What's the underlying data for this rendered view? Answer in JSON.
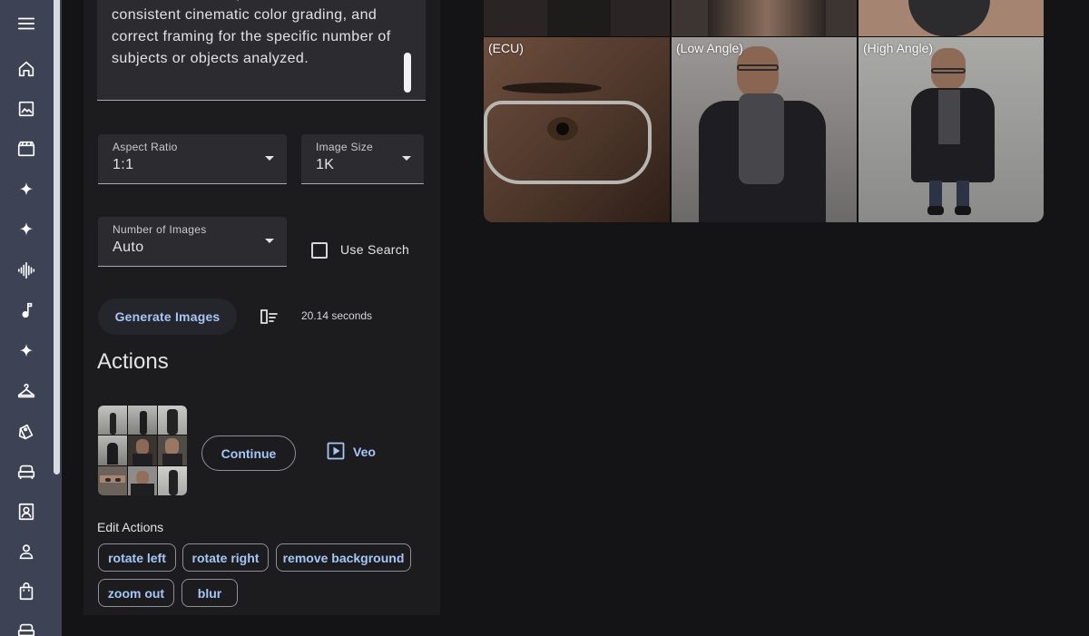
{
  "prompt": {
    "text": "All frames feature photorealistic textures, consistent cinematic color grading, and correct framing for the specific number of subjects or objects analyzed."
  },
  "settings": {
    "aspect_ratio": {
      "label": "Aspect Ratio",
      "value": "1:1"
    },
    "image_size": {
      "label": "Image Size",
      "value": "1K"
    },
    "number_of_images": {
      "label": "Number of Images",
      "value": "Auto"
    },
    "use_search": {
      "label": "Use Search",
      "checked": false
    }
  },
  "generate": {
    "button_label": "Generate Images",
    "timing": "20.14 seconds"
  },
  "actions": {
    "title": "Actions",
    "continue_label": "Continue",
    "veo_label": "Veo"
  },
  "edit_actions": {
    "title": "Edit Actions",
    "chips": [
      "rotate left",
      "rotate right",
      "remove background",
      "zoom out",
      "blur"
    ]
  },
  "image_grid": {
    "captions": [
      "(ECU)",
      "(Low Angle)",
      "(High Angle)"
    ]
  },
  "sidebar": {
    "icons": [
      "menu-icon",
      "home-icon",
      "image-icon",
      "clapperboard-icon",
      "sparkle-icon",
      "sparkle-icon",
      "audio-wave-icon",
      "music-note-icon",
      "sparkle-icon",
      "hanger-icon",
      "tag-icon",
      "couch-icon",
      "portrait-icon",
      "person-icon",
      "shopping-bag-icon",
      "sofa-icon"
    ]
  },
  "colors": {
    "sidebar_bg": "#3d4254",
    "accent": "#a6c6f7",
    "panel_bg": "#1c1c1f",
    "page_bg": "#141416"
  }
}
